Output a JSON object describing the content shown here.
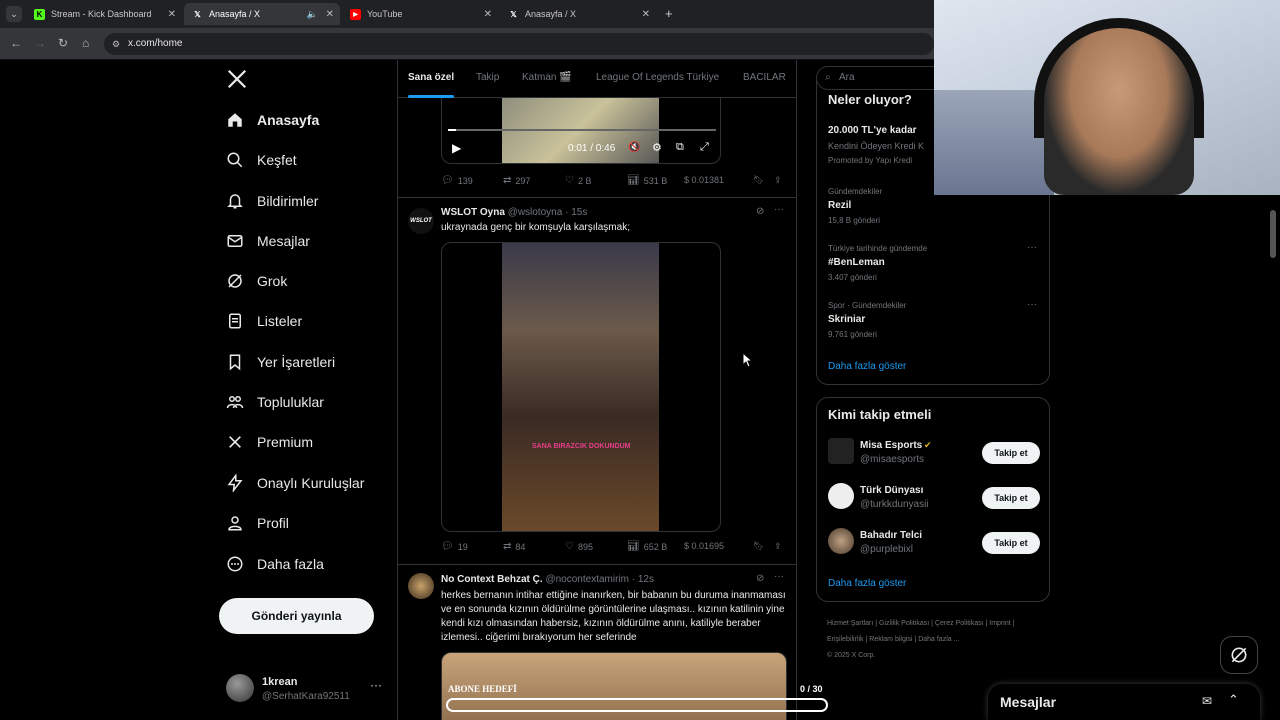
{
  "browser": {
    "tabs": [
      {
        "title": "Stream - Kick Dashboard",
        "active": false
      },
      {
        "title": "Anasayfa / X",
        "active": true
      },
      {
        "title": "YouTube",
        "active": false
      },
      {
        "title": "Anasayfa / X",
        "active": false
      }
    ],
    "url": "x.com/home"
  },
  "nav": {
    "items": [
      {
        "label": "Anasayfa",
        "icon": "home-icon"
      },
      {
        "label": "Keşfet",
        "icon": "search-icon"
      },
      {
        "label": "Bildirimler",
        "icon": "bell-icon"
      },
      {
        "label": "Mesajlar",
        "icon": "mail-icon"
      },
      {
        "label": "Grok",
        "icon": "grok-icon"
      },
      {
        "label": "Listeler",
        "icon": "list-icon"
      },
      {
        "label": "Yer İşaretleri",
        "icon": "bookmark-icon"
      },
      {
        "label": "Topluluklar",
        "icon": "people-icon"
      },
      {
        "label": "Premium",
        "icon": "x-icon"
      },
      {
        "label": "Onaylı Kuruluşlar",
        "icon": "lightning-icon"
      },
      {
        "label": "Profil",
        "icon": "person-icon"
      },
      {
        "label": "Daha fazla",
        "icon": "more-circle-icon"
      }
    ],
    "post_button": "Gönderi yayınla",
    "account": {
      "name": "1krean",
      "handle": "@SerhatKara92511"
    }
  },
  "timeline": {
    "tabs": [
      "Sana özel",
      "Takip",
      "Katman 🎬",
      "League Of Legends Türkiye",
      "BACILAR"
    ],
    "video_time": "0:01 / 0:46",
    "tweet1_actions": {
      "reply": "139",
      "retweet": "297",
      "like": "2 B",
      "views": "531 B",
      "tip": "$ 0.01381"
    },
    "tweet2": {
      "name": "WSLOT Oyna",
      "handle": "@wslotoyna",
      "time": "· 15s",
      "text": "ukraynada genç bir komşuyla karşılaşmak;",
      "overlay": "SANA BIRAZCIK DOKUNDUM",
      "actions": {
        "reply": "19",
        "retweet": "84",
        "like": "895",
        "views": "652 B",
        "tip": "$ 0.01695"
      }
    },
    "tweet3": {
      "name": "No Context Behzat Ç.",
      "handle": "@nocontextamirim",
      "time": "· 12s",
      "text": "herkes bernanın intihar ettiğine inanırken, bir babanın bu duruma inanmaması ve en sonunda kızının öldürülme görüntülerine ulaşması.. kızının katilinin yine kendi kızı olmasından habersiz, kızının öldürülme anını, katiliyle beraber izlemesi.. ciğerimi bırakıyorum her seferinde"
    }
  },
  "goal_overlay": {
    "label": "ABONE HEDEFİ",
    "count": "0 / 30",
    "progress": 0
  },
  "right": {
    "search_placeholder": "Ara",
    "whats_happening": "Neler oluyor?",
    "promo": {
      "title": "20.000 TL'ye kadar",
      "sub": "Kendini Ödeyen Kredi K",
      "by": "Promoted by Yapı Kredi"
    },
    "trends": [
      {
        "context": "Gündemdekiler",
        "name": "Rezil",
        "count": "15,8 B gönderi"
      },
      {
        "context": "Türkiye tarihinde gündemde",
        "name": "#BenLeman",
        "count": "3.407 gönderi"
      },
      {
        "context": "Spor · Gündemdekiler",
        "name": "Skriniar",
        "count": "9.761 gönderi"
      }
    ],
    "show_more": "Daha fazla göster",
    "who_to_follow": "Kimi takip etmeli",
    "follows": [
      {
        "name": "Misa Esports",
        "handle": "@misaesports",
        "button": "Takip et"
      },
      {
        "name": "Türk Dünyası",
        "handle": "@turkkdunyasii",
        "button": "Takip et"
      },
      {
        "name": "Bahadır Telci",
        "handle": "@purplebixl",
        "button": "Takip et"
      }
    ],
    "show_more2": "Daha fazla göster",
    "footer": [
      "Hizmet Şartları",
      "Gizlilik Politikası",
      "Çerez Politikası",
      "Imprint",
      "Erişilebilirlik",
      "Reklam bilgisi",
      "Daha fazla ...",
      "© 2025 X Corp."
    ]
  },
  "messages_drawer": {
    "title": "Mesajlar"
  },
  "colors": {
    "accent": "#1d9bf0",
    "bg": "#000000",
    "border": "#2f3336"
  }
}
